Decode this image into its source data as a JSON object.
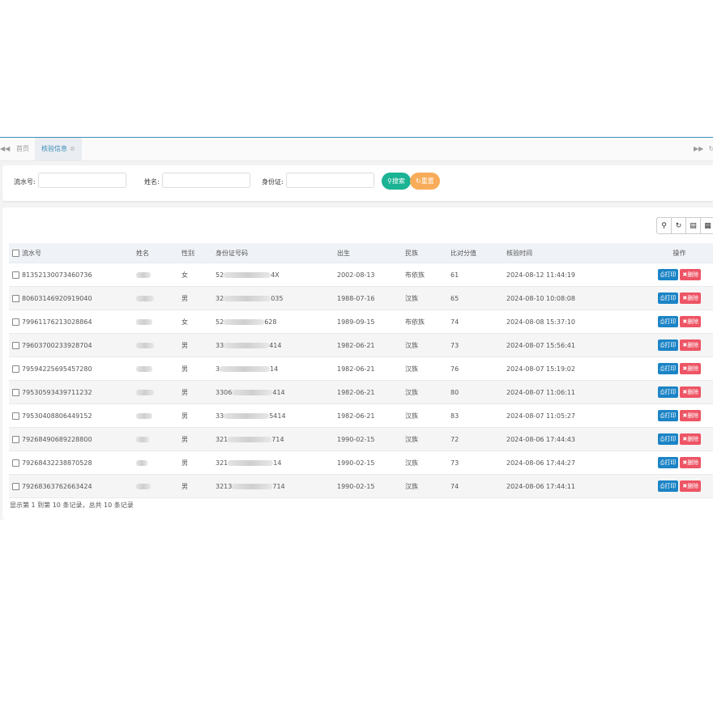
{
  "tabs": {
    "home": "首页",
    "active": "核验信息"
  },
  "search": {
    "serial_label": "流水号:",
    "name_label": "姓名:",
    "id_label": "身份证:",
    "search_button": "搜索",
    "reset_button": "重置"
  },
  "table": {
    "headers": [
      "流水号",
      "姓名",
      "性别",
      "身份证号码",
      "出生",
      "民族",
      "比对分值",
      "核验时间",
      "操作"
    ],
    "print_label": "打印",
    "delete_label": "删除",
    "rows": [
      {
        "serial": "81352130073460736",
        "gender": "女",
        "id_start": "52",
        "id_end": "4X",
        "birth": "2002-08-13",
        "ethnic": "布依族",
        "score": "61",
        "time": "2024-08-12 11:44:19"
      },
      {
        "serial": "80603146920919040",
        "gender": "男",
        "id_start": "32",
        "id_end": "035",
        "birth": "1988-07-16",
        "ethnic": "汉族",
        "score": "65",
        "time": "2024-08-10 10:08:08"
      },
      {
        "serial": "79961176213028864",
        "gender": "女",
        "id_start": "52",
        "id_end": "628",
        "birth": "1989-09-15",
        "ethnic": "布依族",
        "score": "74",
        "time": "2024-08-08 15:37:10"
      },
      {
        "serial": "79603700233928704",
        "gender": "男",
        "id_start": "33",
        "id_end": "414",
        "birth": "1982-06-21",
        "ethnic": "汉族",
        "score": "73",
        "time": "2024-08-07 15:56:41"
      },
      {
        "serial": "79594225695457280",
        "gender": "男",
        "id_start": "3",
        "id_end": "14",
        "birth": "1982-06-21",
        "ethnic": "汉族",
        "score": "76",
        "time": "2024-08-07 15:19:02"
      },
      {
        "serial": "79530593439711232",
        "gender": "男",
        "id_start": "3306",
        "id_end": "414",
        "birth": "1982-06-21",
        "ethnic": "汉族",
        "score": "80",
        "time": "2024-08-07 11:06:11"
      },
      {
        "serial": "79530408806449152",
        "gender": "男",
        "id_start": "33",
        "id_end": "5414",
        "birth": "1982-06-21",
        "ethnic": "汉族",
        "score": "83",
        "time": "2024-08-07 11:05:27"
      },
      {
        "serial": "79268490689228800",
        "gender": "男",
        "id_start": "321",
        "id_end": "714",
        "birth": "1990-02-15",
        "ethnic": "汉族",
        "score": "72",
        "time": "2024-08-06 17:44:43"
      },
      {
        "serial": "79268432238870528",
        "gender": "男",
        "id_start": "321",
        "id_end": "14",
        "birth": "1990-02-15",
        "ethnic": "汉族",
        "score": "73",
        "time": "2024-08-06 17:44:27"
      },
      {
        "serial": "79268363762663424",
        "gender": "男",
        "id_start": "3213",
        "id_end": "714",
        "birth": "1990-02-15",
        "ethnic": "汉族",
        "score": "74",
        "time": "2024-08-06 17:44:11"
      }
    ]
  },
  "footer": "显示第 1 到第 10 条记录，总共 10 条记录"
}
